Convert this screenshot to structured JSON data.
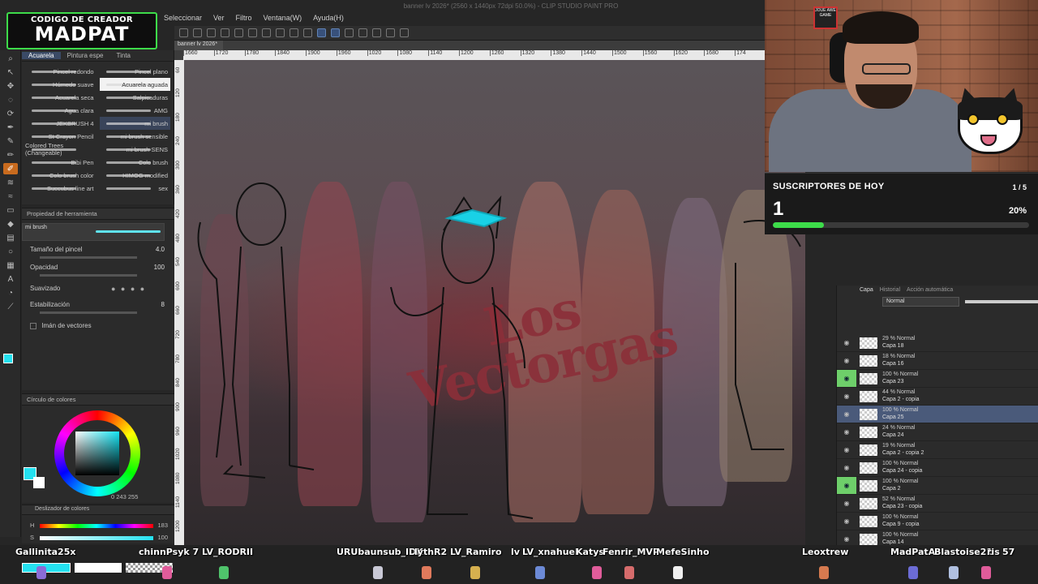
{
  "app": {
    "title": "banner lv 2026* (2560 x 1440px 72dpi 50.0%) - CLIP STUDIO PAINT PRO",
    "menu": [
      "Seleccionar",
      "Ver",
      "Filtro",
      "Ventana(W)",
      "Ayuda(H)"
    ],
    "canvas_tab": "banner lv 2026*"
  },
  "badge": {
    "top": "CODIGO DE CREADOR",
    "name": "MADPAT"
  },
  "brush_panel": {
    "tabs": [
      "Acuarela",
      "Pintura espe",
      "Tinta"
    ],
    "active_tab": 0,
    "brushes": [
      "Pincel redondo",
      "Pincel plano",
      "Húmedo suave",
      "Acuarela aguada",
      "Acuarela seca",
      "Salpicaduras",
      "Agua clara",
      "AMG",
      "JEKBRUSH 4",
      "mi brush",
      "St Crayon Pencil",
      "mi brush sensible",
      "Colored Trees (Changeable)",
      "mi brush SENS",
      "Bibi Pen",
      "Colo brush",
      "Colo brush color",
      "HIMOG modified",
      "Succubus line art",
      "sex"
    ],
    "selected_index": 9
  },
  "tool_property": {
    "header": "Propiedad de herramienta",
    "brush_name": "mi brush",
    "size_label": "Tamaño del pincel",
    "size_value": "4.0",
    "opacity_label": "Opacidad",
    "opacity_value": "100",
    "smoothing_label": "Suavizado",
    "stabilization_label": "Estabilización",
    "stabilization_value": "8",
    "vector_magnet_label": "Imán de vectores"
  },
  "color_circle": {
    "header": "Círculo de colores",
    "hsv_readout": "0 243 255",
    "current_color": "#24e1f0"
  },
  "color_slider": {
    "header": "Deslizador de colores",
    "h_label": "H",
    "h_value": "183",
    "s_label": "S",
    "s_value": "100"
  },
  "ruler": {
    "h_ticks": [
      "1660",
      "1720",
      "1780",
      "1840",
      "1900",
      "1960",
      "1020",
      "1080",
      "1140",
      "1200",
      "1260",
      "1320",
      "1380",
      "1440",
      "1500",
      "1560",
      "1620",
      "1680",
      "174"
    ],
    "v_ticks": [
      "60",
      "120",
      "180",
      "240",
      "300",
      "360",
      "420",
      "480",
      "540",
      "600",
      "660",
      "720",
      "780",
      "840",
      "900",
      "960",
      "1020",
      "1080",
      "1140",
      "1200"
    ]
  },
  "canvas": {
    "logo_line1": "Los",
    "logo_line2": "Vectorgas"
  },
  "webcam": {
    "poster_text": "JOUE AWE GAME"
  },
  "subs_widget": {
    "title": "SUSCRIPTORES DE HOY",
    "count": "1",
    "goal": "1 / 5",
    "percent_label": "20%",
    "progress": 0.2,
    "accent": "#3ddc4a"
  },
  "layer_panel": {
    "tabs": [
      "Capa",
      "Historial",
      "Acción automática"
    ],
    "blend_mode": "Normal",
    "opacity": "100",
    "layers": [
      {
        "mode": "29 % Normal",
        "name": "Capa 18",
        "green": false,
        "selected": false
      },
      {
        "mode": "18 % Normal",
        "name": "Capa 16",
        "green": false,
        "selected": false
      },
      {
        "mode": "100 % Normal",
        "name": "Capa 23",
        "green": true,
        "selected": false
      },
      {
        "mode": "44 % Normal",
        "name": "Capa 2 - copia",
        "green": false,
        "selected": false
      },
      {
        "mode": "100 % Normal",
        "name": "Capa 25",
        "green": false,
        "selected": true
      },
      {
        "mode": "24 % Normal",
        "name": "Capa 24",
        "green": false,
        "selected": false
      },
      {
        "mode": "19 % Normal",
        "name": "Capa 2 - copia 2",
        "green": false,
        "selected": false
      },
      {
        "mode": "100 % Normal",
        "name": "Capa 24 - copia",
        "green": false,
        "selected": false
      },
      {
        "mode": "100 % Normal",
        "name": "Capa 2",
        "green": true,
        "selected": false
      },
      {
        "mode": "52 % Normal",
        "name": "Capa 23 - copia",
        "green": false,
        "selected": false
      },
      {
        "mode": "100 % Normal",
        "name": "Capa 9 - copia",
        "green": false,
        "selected": false
      },
      {
        "mode": "100 % Normal",
        "name": "Capa 14",
        "green": false,
        "selected": false
      }
    ]
  },
  "chat": {
    "names": [
      "Gallinita25x",
      "chinnPsyk 7",
      "LV_RODRII",
      "URUbaunsub_IDK",
      "lythR2",
      "LV_Ramiro",
      "lv",
      "LV_xnahuel",
      "Katys",
      "Fenrir_MVP",
      "MefeSinho",
      "Leoxtrew",
      "MadPatA",
      "Blastoise21",
      "ris",
      "57"
    ]
  }
}
